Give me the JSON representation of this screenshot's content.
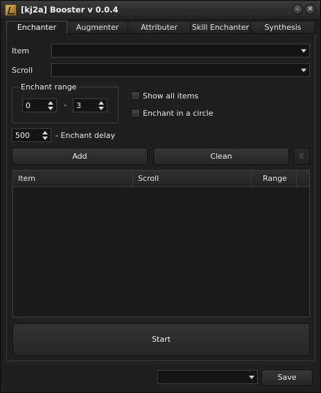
{
  "window": {
    "title": "[kj2a] Booster v 0.0.4",
    "icon": "app-icon",
    "minimize_glyph": "–",
    "close_glyph": "✕"
  },
  "tabs": [
    {
      "label": "Enchanter",
      "active": true
    },
    {
      "label": "Augmenter",
      "active": false
    },
    {
      "label": "Attributer",
      "active": false
    },
    {
      "label": "Skill Enchanter",
      "active": false
    },
    {
      "label": "Synthesis",
      "active": false
    }
  ],
  "enchanter": {
    "item_label": "Item",
    "item_value": "",
    "scroll_label": "Scroll",
    "scroll_value": "",
    "range_group_title": "Enchant range",
    "range_from": "0",
    "range_separator": "-",
    "range_to": "3",
    "show_all_items_label": "Show all items",
    "show_all_items_checked": false,
    "enchant_circle_label": "Enchant in a circle",
    "enchant_circle_checked": false,
    "delay_value": "500",
    "delay_label": "- Enchant delay",
    "add_label": "Add",
    "clean_label": "Clean",
    "x_label": "X",
    "table_headers": [
      "Item",
      "Scroll",
      "Range"
    ],
    "table_rows": [],
    "start_label": "Start"
  },
  "footer": {
    "profile_value": "",
    "save_label": "Save"
  },
  "colors": {
    "background": "#1f1f1f",
    "text": "#e8e8e8",
    "border": "#3e3e3e",
    "icon_gold": "#c9a04f"
  }
}
